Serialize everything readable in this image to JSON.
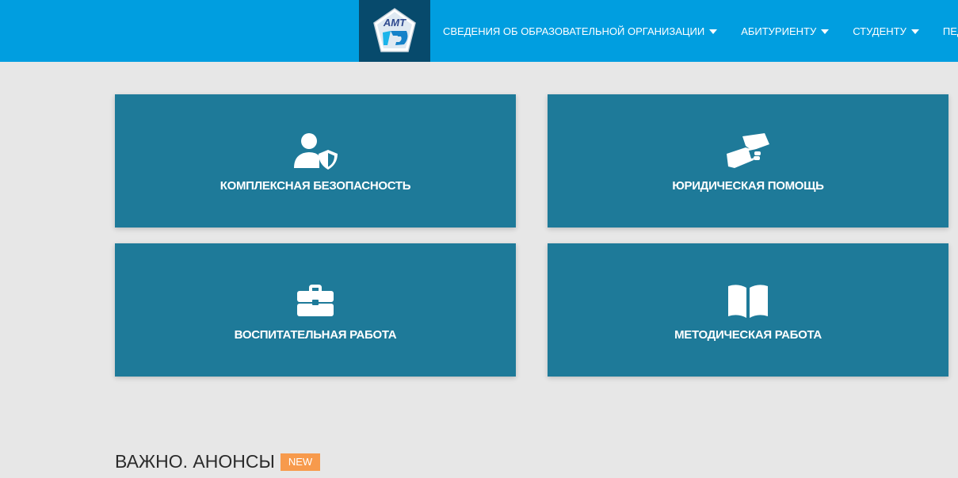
{
  "header": {
    "brand_color": "#009ee0",
    "logo_bg": "#074a6c",
    "logo_alt": "АМТ",
    "nav": [
      {
        "label": "СВЕДЕНИЯ ОБ ОБРАЗОВАТЕЛЬНОЙ ОРГАНИЗАЦИИ",
        "has_dropdown": true
      },
      {
        "label": "АБИТУРИЕНТУ",
        "has_dropdown": true
      },
      {
        "label": "СТУДЕНТУ",
        "has_dropdown": true
      },
      {
        "label": "ПЕДАГОГИЧЕ",
        "has_dropdown": false
      }
    ]
  },
  "tiles": [
    {
      "label": "КОМПЛЕКСНАЯ БЕЗОПАСНОСТЬ",
      "icon": "user-shield-icon"
    },
    {
      "label": "ЮРИДИЧЕСКАЯ ПОМОЩЬ",
      "icon": "handshake-icon"
    },
    {
      "label": "ВОСПИТАТЕЛЬНАЯ РАБОТА",
      "icon": "briefcase-icon"
    },
    {
      "label": "МЕТОДИЧЕСКАЯ РАБОТА",
      "icon": "open-book-icon"
    }
  ],
  "tile_color": "#1e7a99",
  "announcements": {
    "title": "ВАЖНО. АНОНСЫ",
    "badge": "NEW",
    "badge_color": "#f79a4c"
  }
}
